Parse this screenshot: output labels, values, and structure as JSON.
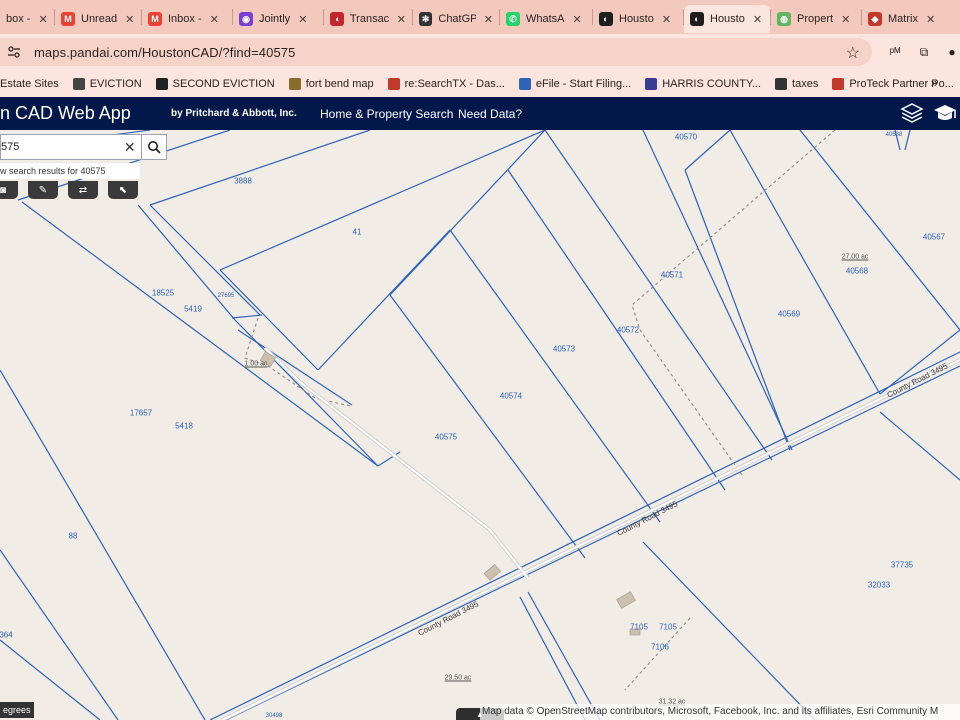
{
  "browser": {
    "tabs": [
      {
        "label": "box -",
        "icon": "inbox-icon",
        "color": "#e8b7aa",
        "glyph": ""
      },
      {
        "label": "Unread",
        "icon": "gmail-icon",
        "color": "#ea4335",
        "glyph": "M"
      },
      {
        "label": "Inbox -",
        "icon": "gmail-icon",
        "color": "#ea4335",
        "glyph": "M"
      },
      {
        "label": "Jointly",
        "icon": "jointly-icon",
        "color": "#7a3fd0",
        "glyph": "◉"
      },
      {
        "label": "Transac",
        "icon": "transaction-icon",
        "color": "#c4262e",
        "glyph": "◖"
      },
      {
        "label": "ChatGP",
        "icon": "chatgpt-icon",
        "color": "#333333",
        "glyph": "✻"
      },
      {
        "label": "WhatsA",
        "icon": "whatsapp-icon",
        "color": "#25d366",
        "glyph": "✆"
      },
      {
        "label": "Housto",
        "icon": "houston-cad-icon",
        "color": "#1e1e1e",
        "glyph": "◐"
      },
      {
        "label": "Housto",
        "icon": "houston-cad-icon",
        "color": "#1e1e1e",
        "glyph": "◐",
        "active": true
      },
      {
        "label": "Propert",
        "icon": "property-icon",
        "color": "#5fb85f",
        "glyph": "◍"
      },
      {
        "label": "Matrix",
        "icon": "matrix-icon",
        "color": "#c0392b",
        "glyph": "◆"
      }
    ],
    "tab_close_glyph": "✕",
    "url": "maps.pandai.com/HoustonCAD/?find=40575",
    "star_glyph": "☆",
    "extensions": [
      {
        "name": "pm-extension-icon",
        "glyph": "ᵖᴹ"
      },
      {
        "name": "puzzle-extension-icon",
        "glyph": "⧉"
      },
      {
        "name": "profile-icon",
        "glyph": "●"
      }
    ],
    "bookmarks": [
      {
        "label": "Estate Sites",
        "icon": "folder-icon",
        "color": ""
      },
      {
        "label": "EVICTION",
        "icon": "scale-icon",
        "color": "#444444"
      },
      {
        "label": "SECOND EVICTION",
        "icon": "globe-icon",
        "color": "#222222"
      },
      {
        "label": "fort bend map",
        "icon": "seal-icon",
        "color": "#8a6d2c"
      },
      {
        "label": "re:SearchTX - Das...",
        "icon": "research-icon",
        "color": "#c0392b"
      },
      {
        "label": "eFile - Start Filing...",
        "icon": "efile-icon",
        "color": "#2f63b8"
      },
      {
        "label": "HARRIS COUNTY...",
        "icon": "harris-county-icon",
        "color": "#3b3b8f"
      },
      {
        "label": "taxes",
        "icon": "taxes-icon",
        "color": "#333333"
      },
      {
        "label": "ProTeck Partner Po...",
        "icon": "proteck-icon",
        "color": "#c0392b"
      }
    ],
    "bookmarks_more": "»"
  },
  "app": {
    "title": "n CAD Web App",
    "byline": "by Pritchard & Abbott, Inc.",
    "nav": [
      "Home & Property Search",
      "Need Data?"
    ],
    "header_color": "#03184a"
  },
  "search": {
    "value": "575",
    "hint": "w search results for 40575",
    "clear_glyph": "✕"
  },
  "tools": [
    {
      "name": "identify-tool-button",
      "glyph": "◙"
    },
    {
      "name": "measure-tool-button",
      "glyph": "✎"
    },
    {
      "name": "swap-tool-button",
      "glyph": "⇄"
    },
    {
      "name": "select-tool-button",
      "glyph": "⬉"
    }
  ],
  "map": {
    "parcel_color": "#2f63b8",
    "background": "#f1ece6",
    "parcel_ids": [
      {
        "id": "3888",
        "small": false
      },
      {
        "id": "41",
        "small": false
      },
      {
        "id": "18525",
        "small": false
      },
      {
        "id": "27695",
        "small": true
      },
      {
        "id": "5419",
        "small": false
      },
      {
        "id": "17657",
        "small": false
      },
      {
        "id": "5418",
        "small": false
      },
      {
        "id": "88",
        "small": false
      },
      {
        "id": "364",
        "small": false
      },
      {
        "id": "40570",
        "small": false
      },
      {
        "id": "40538",
        "small": true
      },
      {
        "id": "40567",
        "small": false
      },
      {
        "id": "40568",
        "small": false
      },
      {
        "id": "40571",
        "small": false
      },
      {
        "id": "40569",
        "small": false
      },
      {
        "id": "40572",
        "small": false
      },
      {
        "id": "40573",
        "small": false
      },
      {
        "id": "40574",
        "small": false
      },
      {
        "id": "40575",
        "small": false
      },
      {
        "id": "37735",
        "small": false
      },
      {
        "id": "32033",
        "small": false
      },
      {
        "id": "7105",
        "small": false
      },
      {
        "id": "7105",
        "small": false
      },
      {
        "id": "7106",
        "small": false
      },
      {
        "id": "30498",
        "small": true
      }
    ],
    "acreage_labels": [
      "1.00 ac",
      "27.00 ac",
      "29.50 ac",
      "31.32 ac"
    ],
    "road_labels": [
      "County Road 3495",
      "County Road 3495",
      "County Road 3495"
    ],
    "attribution": "Map data © OpenStreetMap contributors, Microsoft, Facebook, Inc. and its affiliates, Esri Community M",
    "coord_readout": "egrees"
  }
}
